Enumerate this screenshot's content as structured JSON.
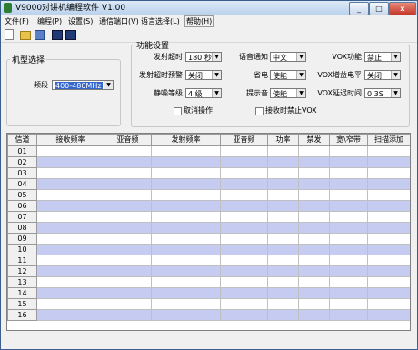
{
  "window": {
    "title": "V9000对讲机编程软件 V1.00",
    "controls": [
      "_",
      "□",
      "x"
    ]
  },
  "menu": [
    {
      "label": "文件(F)"
    },
    {
      "label": "编程(P)"
    },
    {
      "label": "设置(S)"
    },
    {
      "label": "通信端口(V)"
    },
    {
      "label": "语言选择(L)"
    },
    {
      "label": "帮助(H)"
    }
  ],
  "toolbar": {
    "icons": [
      "new-file-icon",
      "open-folder-icon",
      "save-icon",
      "read-radio-icon",
      "write-radio-icon"
    ]
  },
  "model_group": {
    "legend": "机型选择",
    "band_label": "频段",
    "band_value": "400-480MHz"
  },
  "settings": {
    "legend": "功能设置",
    "tx_timeout": {
      "label": "发射超时",
      "value": "180 秒"
    },
    "tx_timeout_warn": {
      "label": "发射超时预警",
      "value": "关闭"
    },
    "squelch": {
      "label": "静噪等级",
      "value": "4 级"
    },
    "voice_prompt": {
      "label": "语音通知",
      "value": "中文"
    },
    "power_save": {
      "label": "省电",
      "value": "使能"
    },
    "beep": {
      "label": "提示音",
      "value": "使能"
    },
    "vox": {
      "label": "VOX功能",
      "value": "禁止"
    },
    "vox_gain": {
      "label": "VOX增益电平",
      "value": "关闭"
    },
    "vox_delay": {
      "label": "VOX延迟时间",
      "value": "0.3S"
    },
    "cancel_op": {
      "label": "取消操作",
      "checked": false
    },
    "rx_disable_vox": {
      "label": "接收时禁止VOX",
      "checked": false
    }
  },
  "channel_table": {
    "headers": [
      "信道",
      "接收频率",
      "亚音频",
      "发射频率",
      "亚音频",
      "功率",
      "禁发",
      "宽\\窄带",
      "扫描添加"
    ],
    "rows": [
      "01",
      "02",
      "03",
      "04",
      "05",
      "06",
      "07",
      "08",
      "09",
      "10",
      "11",
      "12",
      "13",
      "14",
      "15",
      "16"
    ]
  },
  "colors": {
    "row_stripe": "#c6cbf2",
    "selection": "#3366cc"
  }
}
